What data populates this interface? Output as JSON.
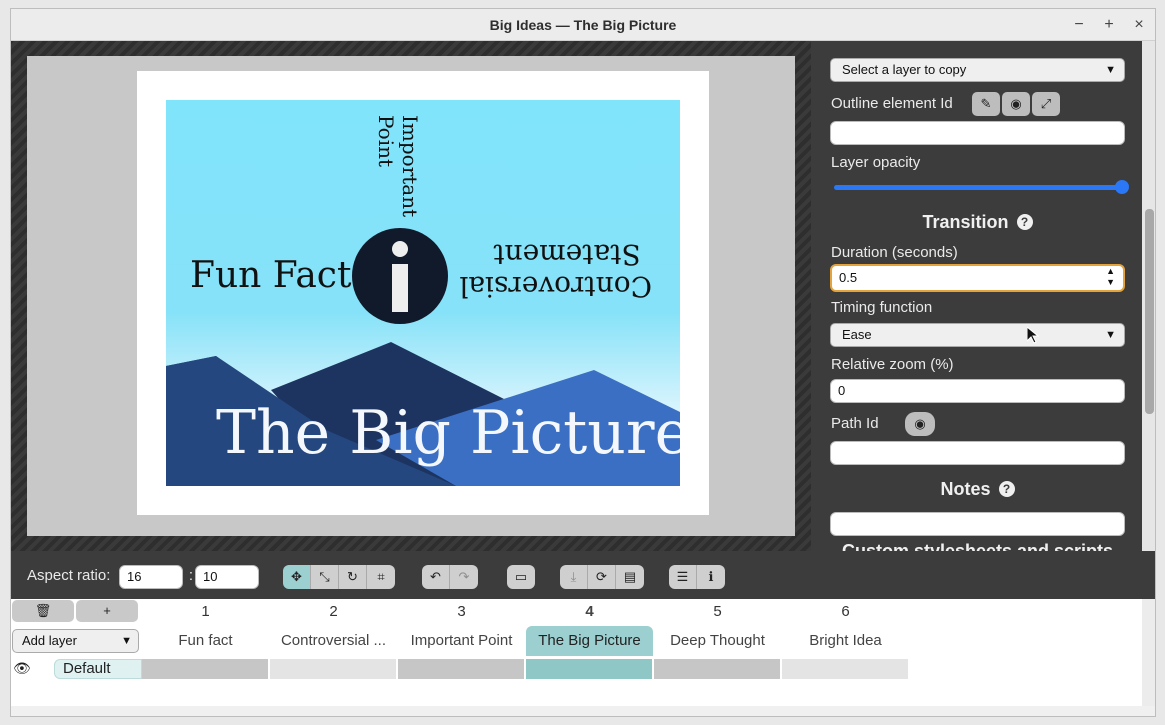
{
  "window": {
    "title": "Big Ideas — The Big Picture",
    "controls": {
      "minimize": "−",
      "maximize": "+",
      "close": "×"
    }
  },
  "slide": {
    "title": "The Big Picture",
    "fun_fact": "Fun Fact",
    "important_line1": "Important",
    "important_line2": "Point",
    "controversial_line1": "Controversial",
    "controversial_line2": "Statement",
    "info_glyph": "i",
    "colors": {
      "sky": "#80e4fb",
      "mountain_dark": "#1d3461",
      "mountain_mid": "#24477f",
      "mountain_light": "#3a6fc4",
      "info_circle": "#111a2b"
    }
  },
  "panel": {
    "copy_layer_select": "Select a layer to copy",
    "outline_label": "Outline element Id",
    "outline_value": "",
    "opacity_label": "Layer opacity",
    "opacity_value": 1.0,
    "transition_heading": "Transition",
    "duration_label": "Duration (seconds)",
    "duration_value": "0.5",
    "timing_label": "Timing function",
    "timing_value": "Ease",
    "zoom_label": "Relative zoom (%)",
    "zoom_value": "0",
    "path_label": "Path Id",
    "path_value": "",
    "notes_heading": "Notes",
    "notes_value": "",
    "custom_heading": "Custom stylesheets and scripts"
  },
  "toolbar": {
    "aspect_label": "Aspect ratio:",
    "aspect_w": "16",
    "aspect_h": "10",
    "aspect_sep": ":"
  },
  "timeline": {
    "add_layer": "Add layer",
    "layer_name": "Default",
    "delete_label": "🗑",
    "add_label": "+",
    "frames": [
      {
        "num": "1",
        "title": "Fun fact"
      },
      {
        "num": "2",
        "title": "Controversial ..."
      },
      {
        "num": "3",
        "title": "Important Point"
      },
      {
        "num": "4",
        "title": "The Big Picture"
      },
      {
        "num": "5",
        "title": "Deep Thought"
      },
      {
        "num": "6",
        "title": "Bright Idea"
      }
    ],
    "selected_frame": 4
  }
}
